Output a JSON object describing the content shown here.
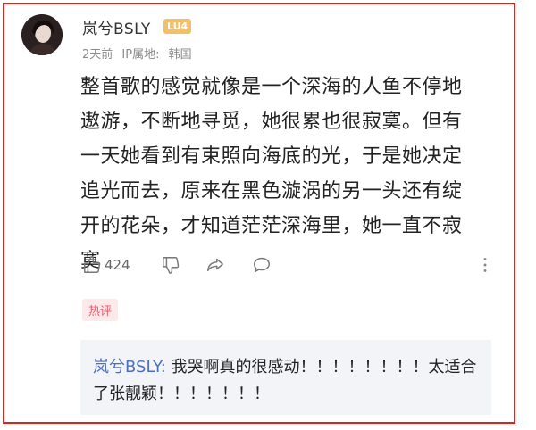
{
  "comment": {
    "username": "岚兮BSLY",
    "level_badge": "LU4",
    "time": "2天前",
    "ip_label": "IP属地:",
    "ip_location": "韩国",
    "text": "整首歌的感觉就像是一个深海的人鱼不停地遨游，不断地寻觅，她很累也很寂寞。但有一天她看到有束照向海底的光，于是她决定追光而去，原来在黑色漩涡的另一头还有绽开的花朵，才知道茫茫深海里，她一直不寂寞",
    "like_count": "424",
    "tag": "热评"
  },
  "reply": {
    "author": "岚兮BSLY:",
    "text": " 我哭啊真的很感动！！！！！！！！太适合了张靓颖！！！！！！！"
  },
  "icons": {
    "like": "thumbs-up-icon",
    "dislike": "thumbs-down-icon",
    "share": "share-icon",
    "comment": "comment-icon",
    "more": "more-vertical-icon"
  },
  "colors": {
    "frame_border": "#d9261c",
    "level_badge": "#f3c06a",
    "hot_tag_bg": "#fde8ea",
    "hot_tag_text": "#e35b6a",
    "reply_author": "#4a6fc1",
    "reply_bg": "#f3f4f8"
  }
}
